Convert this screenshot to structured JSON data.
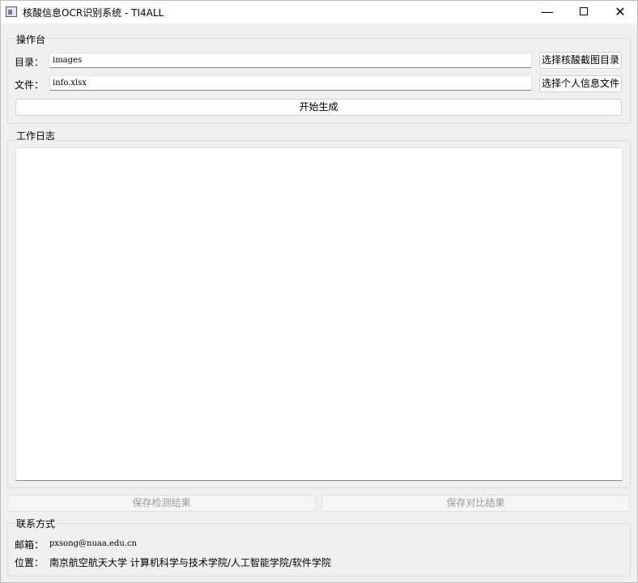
{
  "window": {
    "title": "核酸信息OCR识别系统 - TI4ALL",
    "minimize": "—",
    "close": "✕"
  },
  "ops": {
    "group_title": "操作台",
    "dir_label": "目录：",
    "dir_value": "images",
    "dir_button": "选择核酸截图目录",
    "file_label": "文件：",
    "file_value": "info.xlsx",
    "file_button": "选择个人信息文件",
    "start_button": "开始生成"
  },
  "log": {
    "group_title": "工作日志",
    "content": ""
  },
  "actions": {
    "save_detect": "保存检测结果",
    "save_compare": "保存对比结果"
  },
  "contact": {
    "group_title": "联系方式",
    "email_label": "邮箱：",
    "email_value": "pxsong@nuaa.edu.cn",
    "location_label": "位置：",
    "location_value": "南京航空航天大学 计算机科学与技术学院/人工智能学院/软件学院"
  }
}
